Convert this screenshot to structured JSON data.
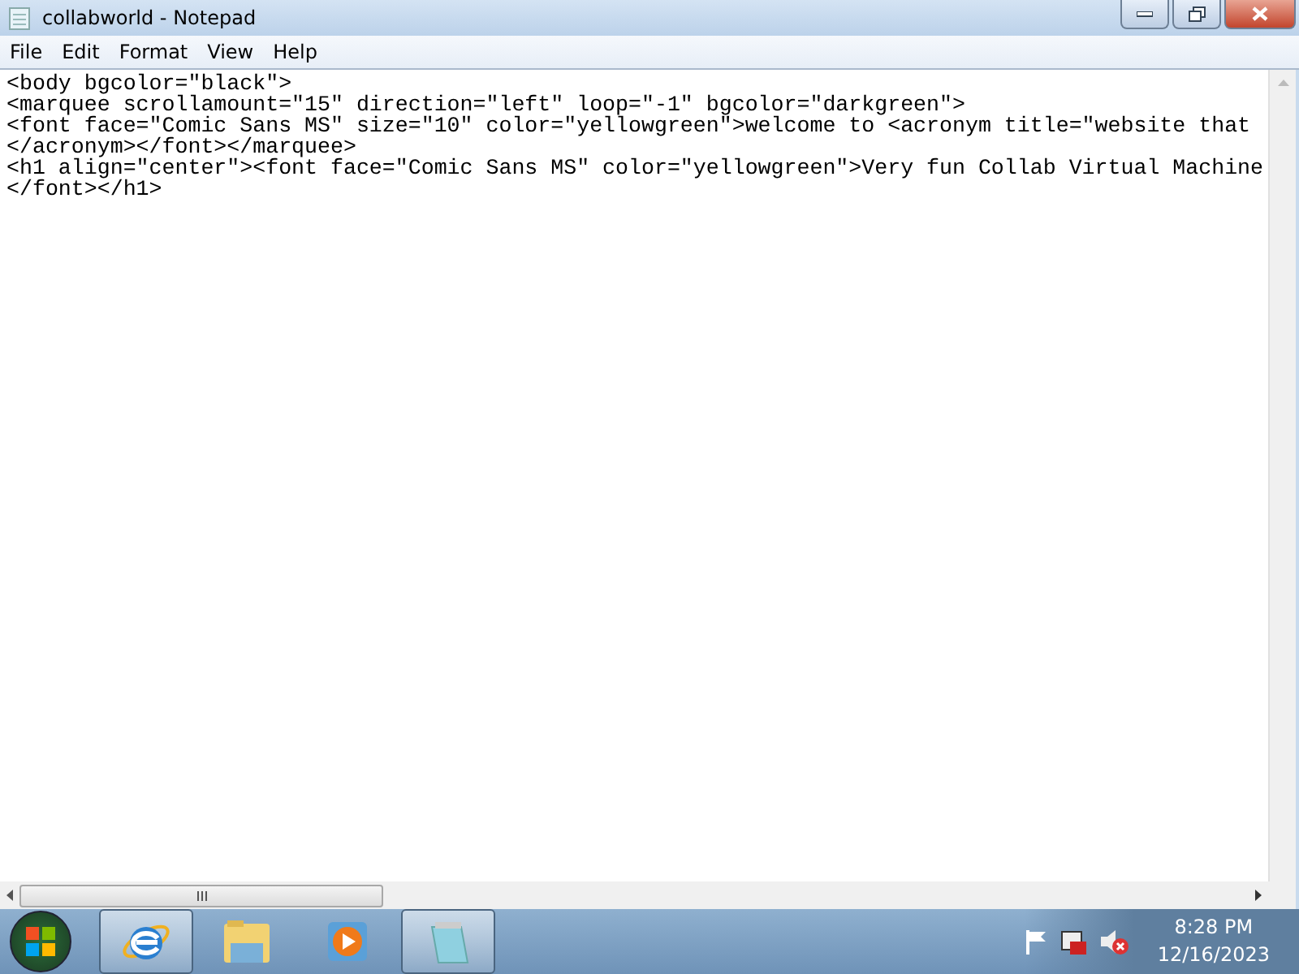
{
  "window": {
    "title": "collabworld - Notepad"
  },
  "menu": [
    "File",
    "Edit",
    "Format",
    "View",
    "Help"
  ],
  "editor": {
    "lines": [
      "<body bgcolor=\"black\">",
      "<marquee scrollamount=\"15\" direction=\"left\" loop=\"-1\" bgcolor=\"darkgreen\">",
      "<font face=\"Comic Sans MS\" size=\"10\" color=\"yellowgreen\">welcome to <acronym title=\"website that",
      "</acronym></font></marquee>",
      "<h1 align=\"center\"><font face=\"Comic Sans MS\" color=\"yellowgreen\">Very fun Collab Virtual Machine",
      "</font></h1>"
    ]
  },
  "taskbar": {
    "items": [
      {
        "kind": "browser",
        "active": true
      },
      {
        "kind": "folder",
        "active": false
      },
      {
        "kind": "media",
        "active": false
      },
      {
        "kind": "notepad",
        "active": true
      }
    ],
    "clock": {
      "time": "8:28 PM",
      "date": "12/16/2023"
    }
  }
}
